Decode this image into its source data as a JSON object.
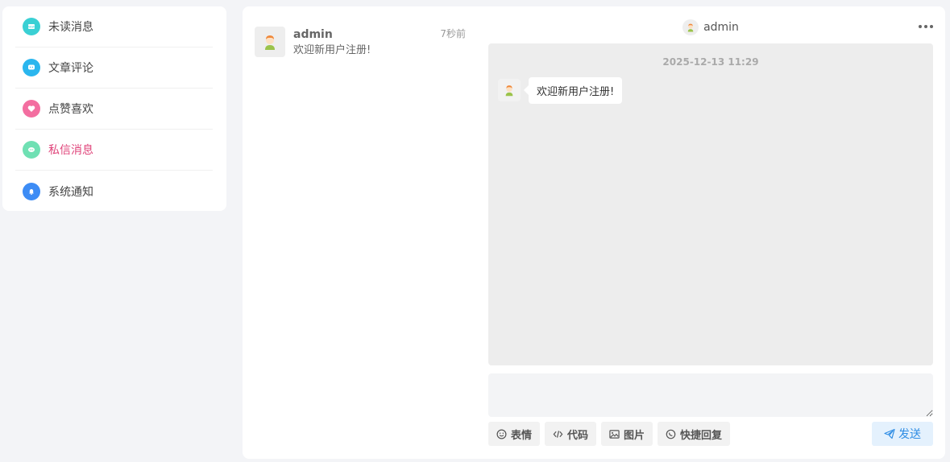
{
  "sidebar": {
    "items": [
      {
        "label": "未读消息",
        "icon": "unread-icon",
        "color": "#3ad0d4"
      },
      {
        "label": "文章评论",
        "icon": "comment-icon",
        "color": "#2bb6ee"
      },
      {
        "label": "点赞喜欢",
        "icon": "heart-icon",
        "color": "#f36ea0"
      },
      {
        "label": "私信消息",
        "icon": "chat-icon",
        "color": "#6fe0b3"
      },
      {
        "label": "系统通知",
        "icon": "bell-icon",
        "color": "#3d8cf5"
      }
    ],
    "active_index": 3,
    "active_color": "#e0457b"
  },
  "conversation": {
    "name": "admin",
    "preview": "欢迎新用户注册!",
    "time": "7秒前"
  },
  "chat": {
    "title": "admin",
    "timestamp": "2025-12-13 11:29",
    "message": "欢迎新用户注册!"
  },
  "input": {
    "value": ""
  },
  "toolbar": {
    "emoji_label": "表情",
    "code_label": "代码",
    "image_label": "图片",
    "quick_reply_label": "快捷回复",
    "send_label": "发送"
  },
  "colors": {
    "accent": "#2f8de4",
    "message_bg": "#ededed"
  }
}
